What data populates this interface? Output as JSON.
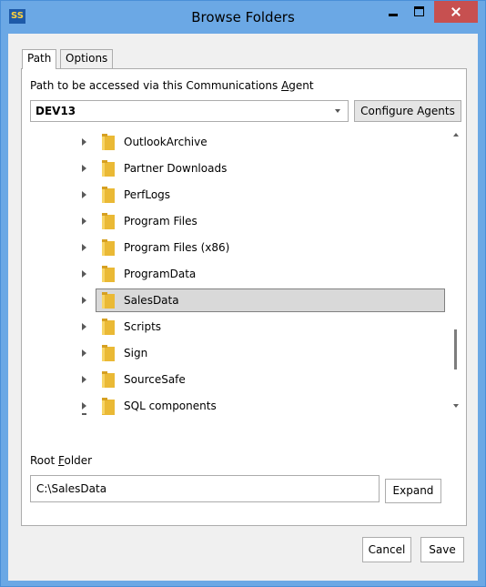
{
  "window": {
    "title": "Browse Folders",
    "app_icon_text": "SS"
  },
  "tabs": [
    {
      "label": "Path"
    },
    {
      "label": "Options"
    }
  ],
  "path_section": {
    "label_before": "Path to be accessed via this Communications ",
    "label_underlined": "A",
    "label_after": "gent",
    "agent_value": "DEV13",
    "configure_label": "Configure Agents"
  },
  "tree": {
    "items": [
      {
        "label": "OutlookArchive"
      },
      {
        "label": "Partner Downloads"
      },
      {
        "label": "PerfLogs"
      },
      {
        "label": "Program Files"
      },
      {
        "label": "Program Files (x86)"
      },
      {
        "label": "ProgramData"
      },
      {
        "label": "SalesData",
        "selected": true
      },
      {
        "label": "Scripts"
      },
      {
        "label": "Sign"
      },
      {
        "label": "SourceSafe"
      },
      {
        "label": "SQL components"
      }
    ]
  },
  "root_folder": {
    "label_before": "Root ",
    "label_underlined": "F",
    "label_after": "older",
    "value": "C:\\SalesData",
    "expand_label": "Expand"
  },
  "footer": {
    "cancel_label": "Cancel",
    "save_label": "Save"
  },
  "colors": {
    "frame": "#6ba8e5",
    "close": "#c75050",
    "selection": "#d9d9d9",
    "folder": "#eab935"
  }
}
